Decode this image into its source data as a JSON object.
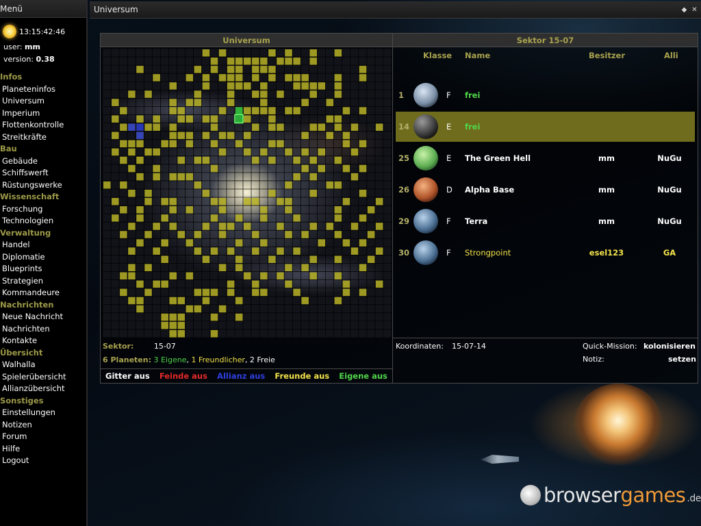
{
  "left_panel": {
    "title": "Menü",
    "clock": "13:15:42:46",
    "user_label": "user:",
    "user_value": "mm",
    "version_label": "version:",
    "version_value": "0.38"
  },
  "menu": {
    "sections": [
      {
        "title": "Infos",
        "items": [
          "Planeteninfos",
          "Universum",
          "Imperium",
          "Flottenkontrolle",
          "Streitkräfte"
        ]
      },
      {
        "title": "Bau",
        "items": [
          "Gebäude",
          "Schiffswerft",
          "Rüstungswerke"
        ]
      },
      {
        "title": "Wissenschaft",
        "items": [
          "Forschung",
          "Technologien"
        ]
      },
      {
        "title": "Verwaltung",
        "items": [
          "Handel",
          "Diplomatie",
          "Blueprints",
          "Strategien",
          "Kommandeure"
        ]
      },
      {
        "title": "Nachrichten",
        "items": [
          "Neue Nachricht",
          "Nachrichten",
          "Kontakte"
        ]
      },
      {
        "title": "Übersicht",
        "items": [
          "Walhalla",
          "Spielerübersicht",
          "Allianzübersicht"
        ]
      },
      {
        "title": "Sonstiges",
        "items": [
          "Einstellungen",
          "Notizen",
          "Forum",
          "Hilfe",
          "Logout"
        ]
      }
    ]
  },
  "window": {
    "title": "Universum",
    "controls": [
      "◆",
      "✕"
    ]
  },
  "universe": {
    "heading": "Universum",
    "sector_label": "Sektor:",
    "sector_value": "15-07",
    "planets_label": "6 Planeten:",
    "own_text": "3 Eigene",
    "friendly_text": "1 Freundlicher",
    "free_text": "2 Freie",
    "sep1": ", ",
    "sep2": ", ",
    "toggles": [
      {
        "label": "Gitter aus",
        "color": "#ffffff"
      },
      {
        "label": "Feinde aus",
        "color": "#e62a2a"
      },
      {
        "label": "Allianz aus",
        "color": "#2f3fe0"
      },
      {
        "label": "Freunde aus",
        "color": "#f2e24a"
      },
      {
        "label": "Eigene aus",
        "color": "#51d64b"
      }
    ],
    "grid": {
      "cols": 35,
      "rows": 35,
      "friend_color": "#b7b224",
      "alliance_color": "#2a3cc8",
      "own_color": "#2bb33a",
      "friend_cells": [
        [
          12,
          0
        ],
        [
          14,
          0
        ],
        [
          20,
          0
        ],
        [
          22,
          0
        ],
        [
          25,
          0
        ],
        [
          28,
          0
        ],
        [
          13,
          1
        ],
        [
          15,
          1
        ],
        [
          16,
          1
        ],
        [
          17,
          1
        ],
        [
          18,
          1
        ],
        [
          19,
          1
        ],
        [
          21,
          1
        ],
        [
          22,
          1
        ],
        [
          23,
          1
        ],
        [
          25,
          1
        ],
        [
          4,
          2
        ],
        [
          11,
          2
        ],
        [
          13,
          2
        ],
        [
          15,
          2
        ],
        [
          16,
          2
        ],
        [
          18,
          2
        ],
        [
          19,
          2
        ],
        [
          20,
          2
        ],
        [
          31,
          2
        ],
        [
          6,
          3
        ],
        [
          10,
          3
        ],
        [
          12,
          3
        ],
        [
          14,
          3
        ],
        [
          15,
          3
        ],
        [
          16,
          3
        ],
        [
          18,
          3
        ],
        [
          20,
          3
        ],
        [
          22,
          3
        ],
        [
          23,
          3
        ],
        [
          24,
          3
        ],
        [
          28,
          3
        ],
        [
          31,
          3
        ],
        [
          8,
          4
        ],
        [
          12,
          4
        ],
        [
          15,
          4
        ],
        [
          16,
          4
        ],
        [
          17,
          4
        ],
        [
          19,
          4
        ],
        [
          23,
          4
        ],
        [
          24,
          4
        ],
        [
          25,
          4
        ],
        [
          26,
          4
        ],
        [
          28,
          4
        ],
        [
          3,
          5
        ],
        [
          5,
          5
        ],
        [
          11,
          5
        ],
        [
          15,
          5
        ],
        [
          18,
          5
        ],
        [
          19,
          5
        ],
        [
          21,
          5
        ],
        [
          25,
          5
        ],
        [
          28,
          5
        ],
        [
          1,
          6
        ],
        [
          8,
          6
        ],
        [
          10,
          6
        ],
        [
          11,
          6
        ],
        [
          15,
          6
        ],
        [
          19,
          6
        ],
        [
          24,
          6
        ],
        [
          27,
          6
        ],
        [
          2,
          7
        ],
        [
          8,
          7
        ],
        [
          9,
          7
        ],
        [
          14,
          7
        ],
        [
          16,
          7
        ],
        [
          17,
          7
        ],
        [
          18,
          7
        ],
        [
          19,
          7
        ],
        [
          20,
          7
        ],
        [
          22,
          7
        ],
        [
          23,
          7
        ],
        [
          29,
          7
        ],
        [
          31,
          7
        ],
        [
          1,
          8
        ],
        [
          4,
          8
        ],
        [
          6,
          8
        ],
        [
          9,
          8
        ],
        [
          10,
          8
        ],
        [
          12,
          8
        ],
        [
          13,
          8
        ],
        [
          17,
          8
        ],
        [
          20,
          8
        ],
        [
          27,
          8
        ],
        [
          28,
          8
        ],
        [
          2,
          9
        ],
        [
          3,
          9
        ],
        [
          5,
          9
        ],
        [
          6,
          9
        ],
        [
          8,
          9
        ],
        [
          13,
          9
        ],
        [
          18,
          9
        ],
        [
          20,
          9
        ],
        [
          21,
          9
        ],
        [
          25,
          9
        ],
        [
          26,
          9
        ],
        [
          28,
          9
        ],
        [
          30,
          9
        ],
        [
          33,
          9
        ],
        [
          1,
          10
        ],
        [
          4,
          10
        ],
        [
          8,
          10
        ],
        [
          9,
          10
        ],
        [
          10,
          10
        ],
        [
          12,
          10
        ],
        [
          14,
          10
        ],
        [
          15,
          10
        ],
        [
          17,
          10
        ],
        [
          24,
          10
        ],
        [
          27,
          10
        ],
        [
          29,
          10
        ],
        [
          2,
          11
        ],
        [
          3,
          11
        ],
        [
          4,
          11
        ],
        [
          7,
          11
        ],
        [
          8,
          11
        ],
        [
          10,
          11
        ],
        [
          13,
          11
        ],
        [
          16,
          11
        ],
        [
          20,
          11
        ],
        [
          21,
          11
        ],
        [
          29,
          11
        ],
        [
          31,
          11
        ],
        [
          1,
          12
        ],
        [
          3,
          12
        ],
        [
          5,
          12
        ],
        [
          6,
          12
        ],
        [
          14,
          12
        ],
        [
          17,
          12
        ],
        [
          19,
          12
        ],
        [
          22,
          12
        ],
        [
          24,
          12
        ],
        [
          26,
          12
        ],
        [
          30,
          12
        ],
        [
          2,
          13
        ],
        [
          4,
          13
        ],
        [
          9,
          13
        ],
        [
          11,
          13
        ],
        [
          12,
          13
        ],
        [
          18,
          13
        ],
        [
          20,
          13
        ],
        [
          23,
          13
        ],
        [
          25,
          13
        ],
        [
          28,
          13
        ],
        [
          3,
          14
        ],
        [
          6,
          14
        ],
        [
          13,
          14
        ],
        [
          24,
          14
        ],
        [
          26,
          14
        ],
        [
          29,
          14
        ],
        [
          31,
          14
        ],
        [
          4,
          15
        ],
        [
          6,
          15
        ],
        [
          8,
          15
        ],
        [
          9,
          15
        ],
        [
          10,
          15
        ],
        [
          23,
          15
        ],
        [
          25,
          15
        ],
        [
          30,
          15
        ],
        [
          0,
          16
        ],
        [
          2,
          16
        ],
        [
          11,
          16
        ],
        [
          22,
          16
        ],
        [
          27,
          16
        ],
        [
          28,
          16
        ],
        [
          3,
          17
        ],
        [
          5,
          17
        ],
        [
          12,
          17
        ],
        [
          20,
          17
        ],
        [
          25,
          17
        ],
        [
          31,
          17
        ],
        [
          1,
          18
        ],
        [
          5,
          18
        ],
        [
          7,
          18
        ],
        [
          8,
          18
        ],
        [
          13,
          18
        ],
        [
          14,
          18
        ],
        [
          17,
          18
        ],
        [
          18,
          18
        ],
        [
          21,
          18
        ],
        [
          22,
          18
        ],
        [
          29,
          18
        ],
        [
          33,
          18
        ],
        [
          2,
          19
        ],
        [
          4,
          19
        ],
        [
          8,
          19
        ],
        [
          10,
          19
        ],
        [
          14,
          19
        ],
        [
          19,
          19
        ],
        [
          22,
          19
        ],
        [
          28,
          19
        ],
        [
          32,
          19
        ],
        [
          1,
          20
        ],
        [
          4,
          20
        ],
        [
          7,
          20
        ],
        [
          13,
          20
        ],
        [
          16,
          20
        ],
        [
          19,
          20
        ],
        [
          23,
          20
        ],
        [
          28,
          20
        ],
        [
          31,
          20
        ],
        [
          3,
          21
        ],
        [
          6,
          21
        ],
        [
          8,
          21
        ],
        [
          12,
          21
        ],
        [
          14,
          21
        ],
        [
          15,
          21
        ],
        [
          17,
          21
        ],
        [
          21,
          21
        ],
        [
          25,
          21
        ],
        [
          27,
          21
        ],
        [
          30,
          21
        ],
        [
          33,
          21
        ],
        [
          2,
          22
        ],
        [
          5,
          22
        ],
        [
          9,
          22
        ],
        [
          11,
          22
        ],
        [
          14,
          22
        ],
        [
          18,
          22
        ],
        [
          22,
          22
        ],
        [
          24,
          22
        ],
        [
          28,
          22
        ],
        [
          32,
          22
        ],
        [
          4,
          23
        ],
        [
          7,
          23
        ],
        [
          10,
          23
        ],
        [
          16,
          23
        ],
        [
          19,
          23
        ],
        [
          26,
          23
        ],
        [
          29,
          23
        ],
        [
          31,
          23
        ],
        [
          3,
          24
        ],
        [
          6,
          24
        ],
        [
          11,
          24
        ],
        [
          13,
          24
        ],
        [
          15,
          24
        ],
        [
          18,
          24
        ],
        [
          21,
          24
        ],
        [
          23,
          24
        ],
        [
          30,
          24
        ],
        [
          33,
          24
        ],
        [
          7,
          25
        ],
        [
          12,
          25
        ],
        [
          16,
          25
        ],
        [
          20,
          25
        ],
        [
          25,
          25
        ],
        [
          28,
          25
        ],
        [
          32,
          25
        ],
        [
          3,
          26
        ],
        [
          5,
          26
        ],
        [
          14,
          26
        ],
        [
          16,
          26
        ],
        [
          22,
          26
        ],
        [
          24,
          26
        ],
        [
          31,
          26
        ],
        [
          2,
          27
        ],
        [
          3,
          27
        ],
        [
          8,
          27
        ],
        [
          10,
          27
        ],
        [
          17,
          27
        ],
        [
          19,
          27
        ],
        [
          21,
          27
        ],
        [
          25,
          27
        ],
        [
          28,
          27
        ],
        [
          4,
          28
        ],
        [
          6,
          28
        ],
        [
          7,
          28
        ],
        [
          15,
          28
        ],
        [
          18,
          28
        ],
        [
          22,
          28
        ],
        [
          29,
          28
        ],
        [
          33,
          28
        ],
        [
          2,
          29
        ],
        [
          5,
          29
        ],
        [
          11,
          29
        ],
        [
          12,
          29
        ],
        [
          13,
          29
        ],
        [
          15,
          29
        ],
        [
          18,
          29
        ],
        [
          19,
          29
        ],
        [
          23,
          29
        ],
        [
          29,
          29
        ],
        [
          31,
          29
        ],
        [
          3,
          30
        ],
        [
          4,
          30
        ],
        [
          8,
          30
        ],
        [
          9,
          30
        ],
        [
          12,
          30
        ],
        [
          16,
          30
        ],
        [
          24,
          30
        ],
        [
          28,
          30
        ],
        [
          4,
          31
        ],
        [
          10,
          31
        ],
        [
          11,
          31
        ],
        [
          14,
          31
        ],
        [
          7,
          32
        ],
        [
          8,
          32
        ],
        [
          9,
          32
        ],
        [
          13,
          32
        ],
        [
          16,
          32
        ],
        [
          7,
          33
        ],
        [
          8,
          33
        ],
        [
          9,
          33
        ],
        [
          8,
          34
        ],
        [
          9,
          34
        ],
        [
          13,
          34
        ]
      ],
      "alliance_cells": [
        [
          3,
          9
        ],
        [
          4,
          9
        ],
        [
          4,
          10
        ]
      ],
      "own_cells": [
        [
          16,
          7
        ],
        [
          16,
          8
        ]
      ]
    }
  },
  "sector": {
    "heading": "Sektor 15-07",
    "headers": {
      "klasse": "Klasse",
      "name": "Name",
      "besitzer": "Besitzer",
      "alli": "Alli"
    },
    "rows": [
      {
        "num": "1",
        "klasse": "F",
        "name": "frei",
        "besitzer": "",
        "alli": "",
        "planet": "planet-ringed-icon",
        "status": "free"
      },
      {
        "num": "14",
        "klasse": "E",
        "name": "frei",
        "besitzer": "",
        "alli": "",
        "planet": "planet-dark-icon",
        "status": "free",
        "selected": true
      },
      {
        "num": "25",
        "klasse": "E",
        "name": "The Green Hell",
        "besitzer": "mm",
        "alli": "NuGu",
        "planet": "planet-green-icon",
        "status": "own"
      },
      {
        "num": "26",
        "klasse": "D",
        "name": "Alpha Base",
        "besitzer": "mm",
        "alli": "NuGu",
        "planet": "planet-red-icon",
        "status": "own"
      },
      {
        "num": "29",
        "klasse": "F",
        "name": "Terra",
        "besitzer": "mm",
        "alli": "NuGu",
        "planet": "planet-blue-icon",
        "status": "own"
      },
      {
        "num": "30",
        "klasse": "F",
        "name": "Strongpoint",
        "besitzer": "esel123",
        "alli": "GA",
        "planet": "planet-blue-icon",
        "status": "friend"
      }
    ],
    "coords_label": "Koordinaten:",
    "coords_value": "15-07-14",
    "quick_label": "Quick-Mission:",
    "quick_value": "kolonisieren",
    "notiz_label": "Notiz:",
    "notiz_value": "setzen"
  },
  "watermark": {
    "browser": "browser",
    "games": "games",
    "de": ".de"
  }
}
